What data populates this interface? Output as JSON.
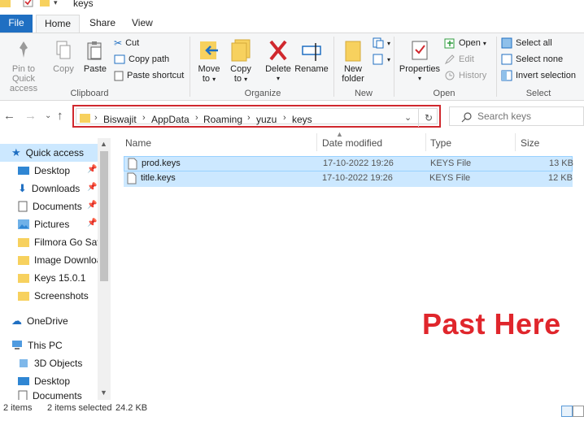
{
  "window": {
    "title": "keys"
  },
  "tabs": {
    "file": "File",
    "home": "Home",
    "share": "Share",
    "view": "View"
  },
  "ribbon": {
    "clipboard": {
      "label": "Clipboard",
      "pin_quick": "Pin to Quick",
      "pin_access": "access",
      "copy": "Copy",
      "paste": "Paste",
      "cut": "Cut",
      "copy_path": "Copy path",
      "paste_shortcut": "Paste shortcut"
    },
    "organize": {
      "label": "Organize",
      "move_to_1": "Move",
      "move_to_2": "to",
      "copy_to_1": "Copy",
      "copy_to_2": "to",
      "delete": "Delete",
      "rename": "Rename"
    },
    "new": {
      "label": "New",
      "new_1": "New",
      "new_2": "folder"
    },
    "open": {
      "label": "Open",
      "properties": "Properties",
      "open": "Open",
      "edit": "Edit",
      "history": "History"
    },
    "select": {
      "label": "Select",
      "select_all": "Select all",
      "select_none": "Select none",
      "invert": "Invert selection"
    }
  },
  "breadcrumb": [
    "Biswajit",
    "AppData",
    "Roaming",
    "yuzu",
    "keys"
  ],
  "search": {
    "placeholder": "Search keys"
  },
  "nav": {
    "quick_access": "Quick access",
    "items": [
      "Desktop",
      "Downloads",
      "Documents",
      "Pictures",
      "Filmora Go Save",
      "Image Download",
      "Keys 15.0.1",
      "Screenshots"
    ],
    "onedrive": "OneDrive",
    "this_pc": "This PC",
    "pc_items": [
      "3D Objects",
      "Desktop",
      "Documents"
    ]
  },
  "columns": {
    "name": "Name",
    "date": "Date modified",
    "type": "Type",
    "size": "Size"
  },
  "files": [
    {
      "name": "prod.keys",
      "date": "17-10-2022 19:26",
      "type": "KEYS File",
      "size": "13 KB"
    },
    {
      "name": "title.keys",
      "date": "17-10-2022 19:26",
      "type": "KEYS File",
      "size": "12 KB"
    }
  ],
  "annotation": "Past Here",
  "status": {
    "count": "2 items",
    "selected": "2 items selected",
    "size": "24.2 KB"
  },
  "colors": {
    "accent": "#1f6fc2",
    "selection": "#cce8ff",
    "highlight_red": "#d0282e",
    "folder": "#f7d15e"
  }
}
